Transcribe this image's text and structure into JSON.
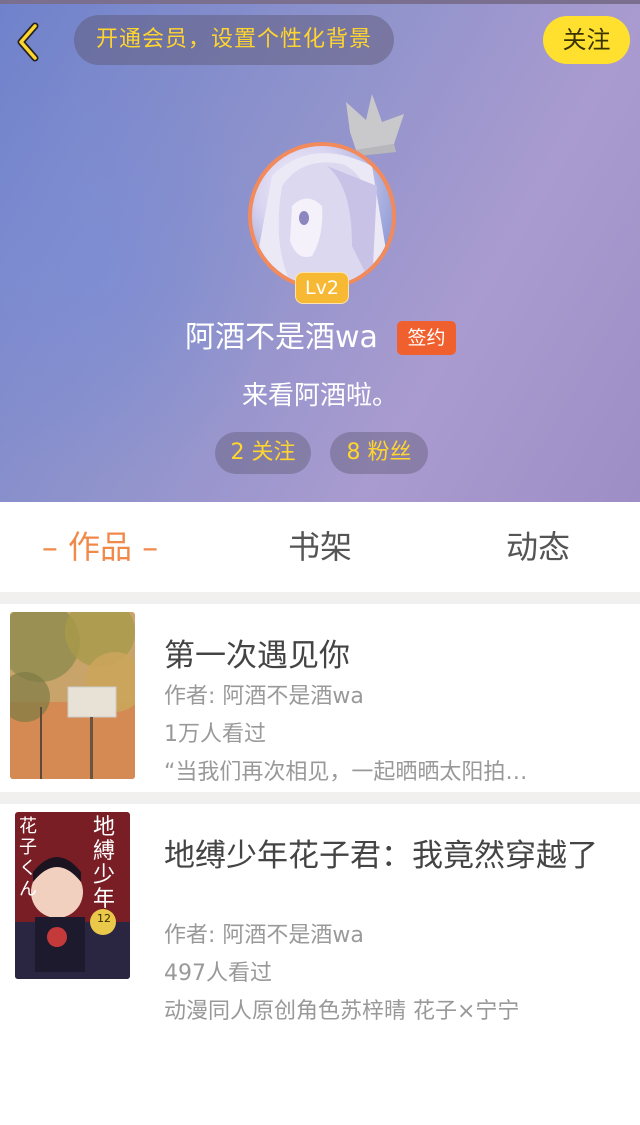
{
  "header": {
    "back_icon": "chevron-left-icon",
    "vip_text": "开通会员，设置个性化背景",
    "follow_label": "关注",
    "crown_icon": "crown-icon",
    "level": "Lv2",
    "username": "阿酒不是酒wa",
    "signed_badge": "签约",
    "bio": "来看阿酒啦。",
    "stats": [
      {
        "label": "2 关注"
      },
      {
        "label": "8 粉丝"
      }
    ],
    "colors": {
      "accent_yellow": "#ffe02e",
      "badge_orange": "#f0602f",
      "level_gold": "#f7b934"
    }
  },
  "tabs": [
    {
      "label": "– 作品 –",
      "active": true
    },
    {
      "label": "书架",
      "active": false
    },
    {
      "label": "动态",
      "active": false
    }
  ],
  "works": [
    {
      "title": "第一次遇见你",
      "author": "作者: 阿酒不是酒wa",
      "views": "1万人看过",
      "desc": "“当我们再次相见，一起晒晒太阳拍…"
    },
    {
      "title": "地缚少年花子君：我竟然穿越了",
      "author": "作者: 阿酒不是酒wa",
      "views": "497人看过",
      "desc": "动漫同人原创角色苏梓晴 花子×宁宁",
      "cover_text": "地縛少年",
      "cover_text2": "花子くん",
      "cover_number": "12"
    }
  ]
}
